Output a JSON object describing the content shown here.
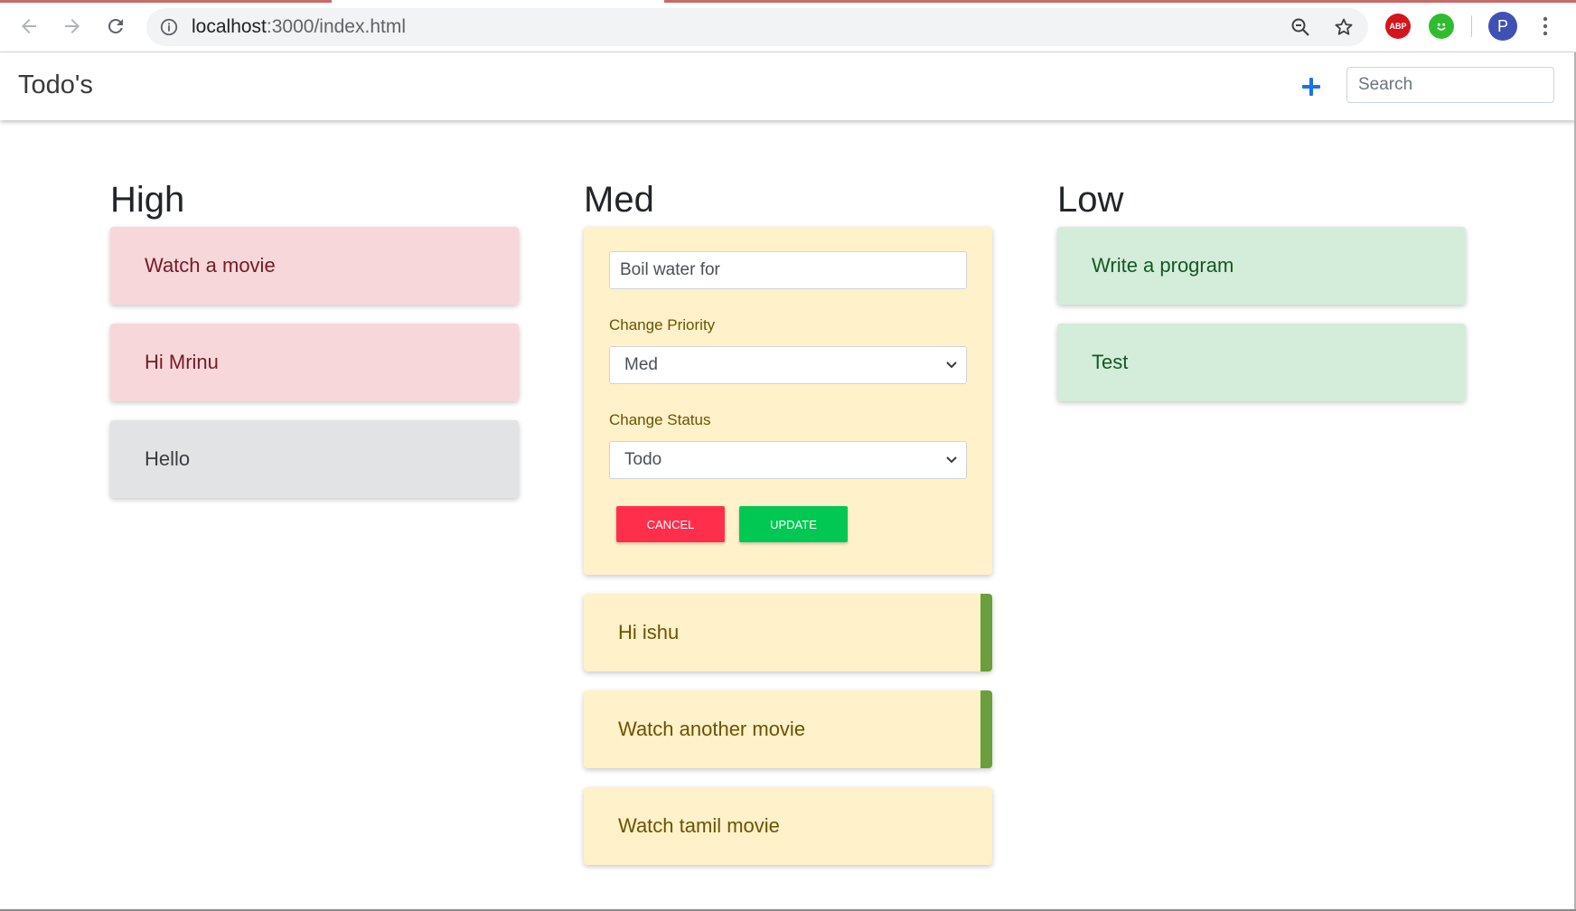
{
  "browser": {
    "url_host": "localhost",
    "url_rest": ":3000/index.html",
    "profile_initial": "P",
    "extension_abp_label": "ABP"
  },
  "navbar": {
    "brand": "Todo's",
    "search_placeholder": "Search"
  },
  "columns": {
    "high": {
      "title": "High",
      "items": [
        "Watch a movie",
        "Hi Mrinu",
        "Hello"
      ]
    },
    "med": {
      "title": "Med",
      "edit": {
        "input_value": "Boil water for",
        "priority_label": "Change Priority",
        "priority_value": "Med",
        "status_label": "Change Status",
        "status_value": "Todo",
        "cancel_label": "CANCEL",
        "update_label": "UPDATE"
      },
      "items": [
        "Hi ishu",
        "Watch another movie",
        "Watch tamil movie"
      ]
    },
    "low": {
      "title": "Low",
      "items": [
        "Write a program",
        "Test"
      ]
    }
  },
  "colors": {
    "high_bg": "#f8d7da",
    "med_bg": "#fff1c9",
    "low_bg": "#d4edda",
    "neutral_bg": "#e2e3e5",
    "cancel": "#ff2e4b",
    "update": "#00c853",
    "accent": "#1a73e8"
  }
}
